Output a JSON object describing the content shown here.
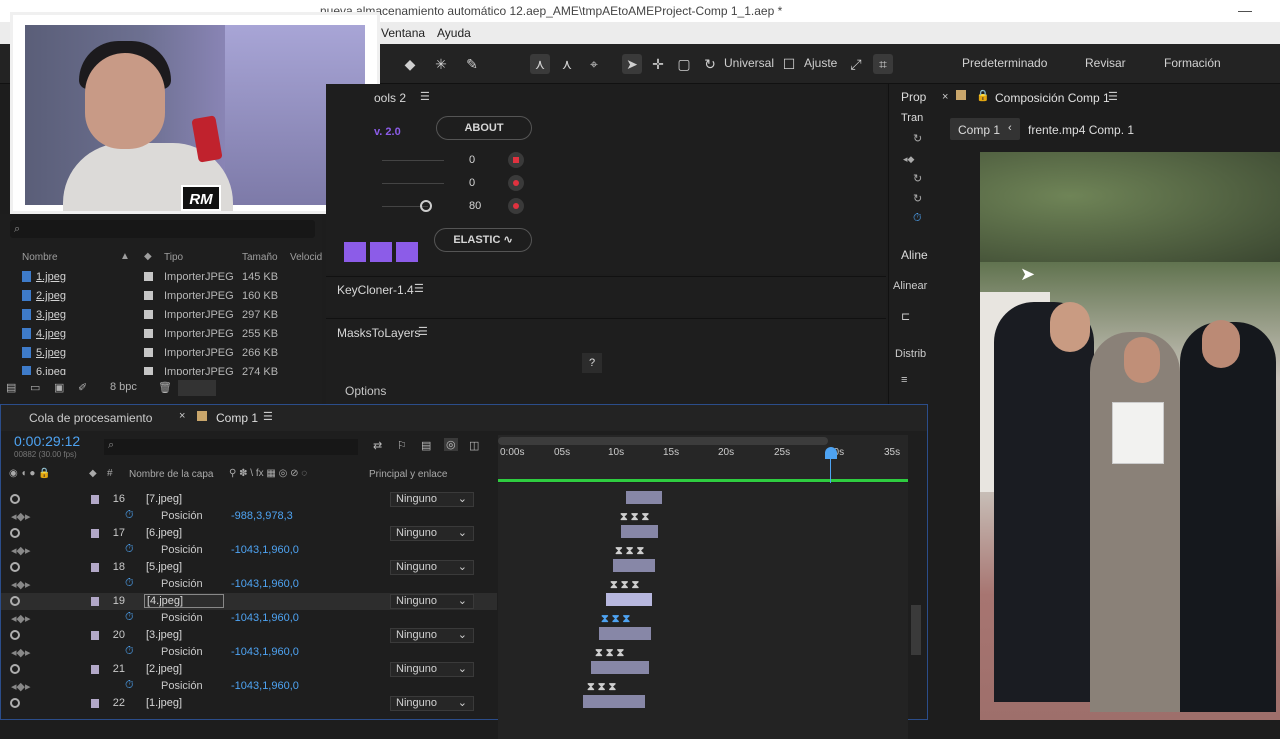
{
  "titlebar": {
    "title": "nueva almacenamiento automático 12.aep_AME\\tmpAEtoAMEProject-Comp 1_1.aep *"
  },
  "menu": [
    "Ventana",
    "Ayuda"
  ],
  "toolbar": {
    "universal": "Universal",
    "ajuste": "Ajuste",
    "workspaces": [
      "Predeterminado",
      "Revisar",
      "Formación"
    ]
  },
  "project": {
    "search_placeholder": "",
    "columns": [
      "Nombre",
      "Tipo",
      "Tamaño",
      "Velocid"
    ],
    "items": [
      {
        "name": "1.jpeg",
        "type": "ImporterJPEG",
        "size": "145 KB"
      },
      {
        "name": "2.jpeg",
        "type": "ImporterJPEG",
        "size": "160 KB"
      },
      {
        "name": "3.jpeg",
        "type": "ImporterJPEG",
        "size": "297 KB"
      },
      {
        "name": "4.jpeg",
        "type": "ImporterJPEG",
        "size": "255 KB"
      },
      {
        "name": "5.jpeg",
        "type": "ImporterJPEG",
        "size": "266 KB"
      },
      {
        "name": "6.jpeg",
        "type": "ImporterJPEG",
        "size": "274 KB"
      }
    ],
    "bpc": "8 bpc"
  },
  "tools_panel": {
    "title": "ools 2",
    "version": "v. 2.0",
    "about": "ABOUT",
    "values": [
      "0",
      "0",
      "80"
    ],
    "elastic": "ELASTIC"
  },
  "keycloner": {
    "title": "KeyCloner-1.4"
  },
  "masks": {
    "title": "MasksToLayers",
    "help": "?",
    "options": "Options"
  },
  "props": {
    "prop": "Prop",
    "tran": "Tran",
    "aline": "Aline",
    "alinear": "Alinear",
    "distrib": "Distrib"
  },
  "comp": {
    "title": "Composición Comp 1",
    "tab_active": "Comp 1",
    "tab_other": "frente.mp4 Comp. 1"
  },
  "timeline": {
    "tab_queue": "Cola de procesamiento",
    "tab_comp": "Comp 1",
    "timecode": "0:00:29:12",
    "fps": "00882 (30.00 fps)",
    "col_layer": "Nombre de la capa",
    "col_parent": "Principal y enlace",
    "ruler": [
      "0:00s",
      "05s",
      "10s",
      "15s",
      "20s",
      "25s",
      "30s",
      "35s"
    ],
    "layers": [
      {
        "num": "16",
        "name": "[7.jpeg]",
        "pos_label": "Posición",
        "pos": "-988,3,978,3",
        "parent": "Ninguno"
      },
      {
        "num": "17",
        "name": "[6.jpeg]",
        "pos_label": "Posición",
        "pos": "-1043,1,960,0",
        "parent": "Ninguno"
      },
      {
        "num": "18",
        "name": "[5.jpeg]",
        "pos_label": "Posición",
        "pos": "-1043,1,960,0",
        "parent": "Ninguno"
      },
      {
        "num": "19",
        "name": "[4.jpeg]",
        "pos_label": "Posición",
        "pos": "-1043,1,960,0",
        "parent": "Ninguno"
      },
      {
        "num": "20",
        "name": "[3.jpeg]",
        "pos_label": "Posición",
        "pos": "-1043,1,960,0",
        "parent": "Ninguno"
      },
      {
        "num": "21",
        "name": "[2.jpeg]",
        "pos_label": "Posición",
        "pos": "-1043,1,960,0",
        "parent": "Ninguno"
      },
      {
        "num": "22",
        "name": "[1.jpeg]",
        "pos_label": "",
        "pos": "",
        "parent": "Ninguno"
      }
    ]
  },
  "colors": {
    "accent_blue": "#4ea3f2",
    "purple": "#8c5ce8",
    "red": "#e0323f",
    "green_bar": "#2ecc40"
  }
}
